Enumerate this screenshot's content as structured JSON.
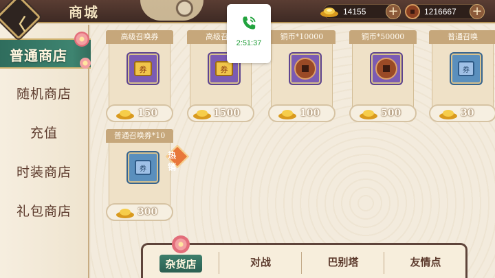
{
  "header": {
    "title": "商城",
    "back_label": "〈"
  },
  "call": {
    "time": "2:51:37"
  },
  "currencies": [
    {
      "name": "gold-ingot",
      "amount": "14155"
    },
    {
      "name": "copper-coin",
      "amount": "1216667"
    }
  ],
  "sidebar": {
    "items": [
      {
        "label": "普通商店",
        "active": true
      },
      {
        "label": "随机商店",
        "active": false
      },
      {
        "label": "充值",
        "active": false
      },
      {
        "label": "时装商店",
        "active": false
      },
      {
        "label": "礼包商店",
        "active": false
      }
    ]
  },
  "shop": {
    "items": [
      {
        "title": "高级召唤券",
        "icon": "summon-ticket-gold",
        "price": "150"
      },
      {
        "title": "高级召唤",
        "icon": "summon-ticket-gold",
        "price": "1500"
      },
      {
        "title": "铜币*10000",
        "icon": "copper-coin",
        "price": "100"
      },
      {
        "title": "铜币*50000",
        "icon": "copper-coin",
        "price": "500"
      },
      {
        "title": "普通召唤",
        "icon": "summon-ticket-blue",
        "price": "30"
      },
      {
        "title": "普通召唤券*10",
        "icon": "summon-ticket-blue",
        "price": "300",
        "badge": "热销"
      }
    ]
  },
  "bottom_tabs": [
    {
      "label": "杂货店",
      "active": true
    },
    {
      "label": "对战",
      "active": false
    },
    {
      "label": "巴别塔",
      "active": false
    },
    {
      "label": "友情点",
      "active": false
    }
  ],
  "colors": {
    "accent_green": "#2f6d5d",
    "brown": "#5c3a2c",
    "gold": "#c9a867"
  }
}
